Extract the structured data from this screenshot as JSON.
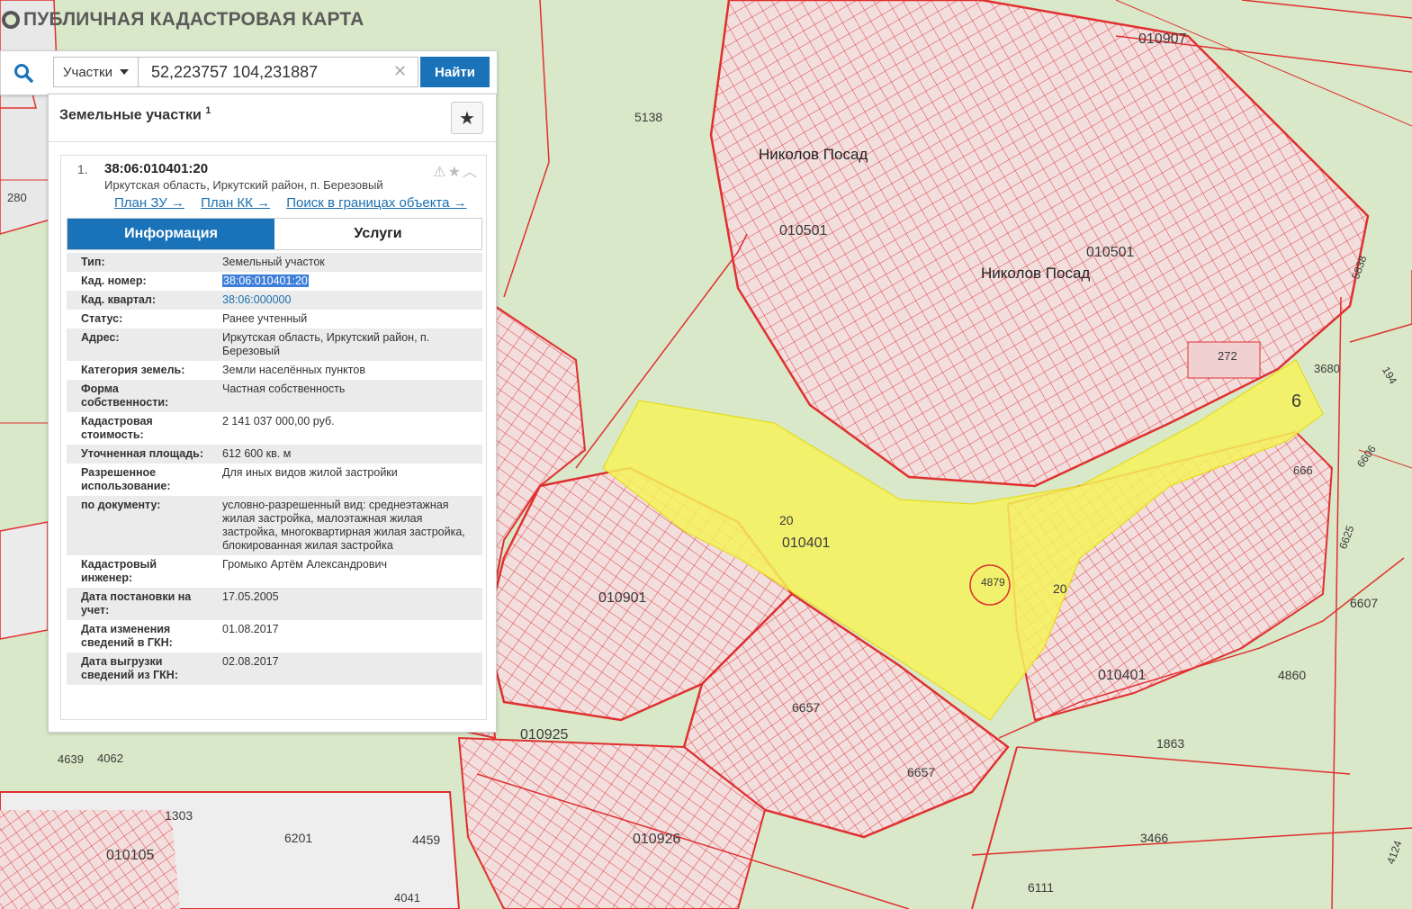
{
  "app": {
    "title": "ПУБЛИЧНАЯ КАДАСТРОВАЯ КАРТА"
  },
  "search": {
    "type_label": "Участки",
    "query": "52,223757 104,231887",
    "find_label": "Найти",
    "icon": "search-icon"
  },
  "panel": {
    "header": "Земельные участки",
    "count": "1"
  },
  "result": {
    "index": "1.",
    "cad_number": "38:06:010401:20",
    "address": "Иркутская область, Иркутский район, п. Березовый",
    "links": [
      "План ЗУ →",
      "План КК →",
      "Поиск в границах объекта →"
    ],
    "tabs": [
      "Информация",
      "Услуги"
    ],
    "rows": [
      {
        "k": "Тип:",
        "v": "Земельный участок"
      },
      {
        "k": "Кад. номер:",
        "v": "38:06:010401:20"
      },
      {
        "k": "Кад. квартал:",
        "v": "38:06:000000"
      },
      {
        "k": "Статус:",
        "v": "Ранее учтенный"
      },
      {
        "k": "Адрес:",
        "v": "Иркутская область, Иркутский район, п. Березовый"
      },
      {
        "k": "Категория земель:",
        "v": "Земли населённых пунктов"
      },
      {
        "k": "Форма собственности:",
        "v": "Частная собственность"
      },
      {
        "k": "Кадастровая стоимость:",
        "v": "2 141 037 000,00 руб."
      },
      {
        "k": "Уточненная площадь:",
        "v": "612 600 кв. м"
      },
      {
        "k": "Разрешенное использование:",
        "v": "Для иных видов жилой застройки"
      },
      {
        "k": "по документу:",
        "v": "условно-разрешенный вид: среднеэтажная жилая застройка, малоэтажная жилая застройка, многоквартирная жилая застройка, блокированная жилая застройка"
      },
      {
        "k": "Кадастровый инженер:",
        "v": "Громыко Артём Александрович"
      },
      {
        "k": "Дата постановки на учет:",
        "v": "17.05.2005"
      },
      {
        "k": "Дата изменения сведений в ГКН:",
        "v": "01.08.2017"
      },
      {
        "k": "Дата выгрузки сведений из ГКН:",
        "v": "02.08.2017"
      }
    ]
  },
  "map_labels": [
    "010907",
    "5138",
    "Николов Посад",
    "010501",
    "010501",
    "Николов Посад",
    "272",
    "3680",
    "6",
    "20",
    "010401",
    "010901",
    "4879",
    "20",
    "010401",
    "6607",
    "4860",
    "1863",
    "6657",
    "6657",
    "010925",
    "010926",
    "3466",
    "6111",
    "4459",
    "6201",
    "1303",
    "010105",
    "4639",
    "4062",
    "4041",
    "280",
    "666",
    "6625",
    "6606",
    "5838",
    "194",
    "4124"
  ],
  "colors": {
    "accent": "#1a73b8",
    "parcel_line": "#e03030",
    "highlight": "#f4f25a",
    "map_bg": "#d9e8c8"
  }
}
